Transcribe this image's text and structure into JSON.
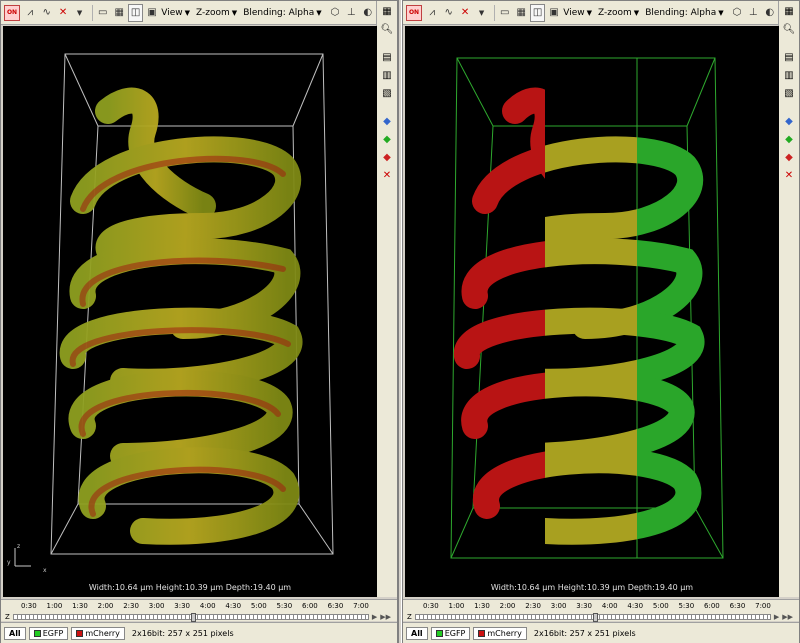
{
  "toolbar": {
    "view_label": "View",
    "zoom_label": "Z-zoom",
    "blending_label": "Blending: Alpha",
    "channel_badge": "ON"
  },
  "panes": [
    {
      "dims_text": "Width:10.64 µm Height:10.39 µm Depth:19.40 µm",
      "timeline_ticks": [
        "0:30",
        "1:00",
        "1:30",
        "2:00",
        "2:30",
        "3:00",
        "3:30",
        "4:00",
        "4:30",
        "5:00",
        "5:30",
        "6:00",
        "6:30",
        "7:00"
      ],
      "z_label": "Z",
      "tabs": {
        "all": "All",
        "egfp": "EGFP",
        "mcherry": "mCherry"
      },
      "status": "2x16bit: 257 x 251 pixels"
    },
    {
      "dims_text": "Width:10.64 µm Height:10.39 µm Depth:19.40 µm",
      "timeline_ticks": [
        "0:30",
        "1:00",
        "1:30",
        "2:00",
        "2:30",
        "3:00",
        "3:30",
        "4:00",
        "4:30",
        "5:00",
        "5:30",
        "6:00",
        "6:30",
        "7:00"
      ],
      "z_label": "Z",
      "tabs": {
        "all": "All",
        "egfp": "EGFP",
        "mcherry": "mCherry"
      },
      "status": "2x16bit: 257 x 251 pixels"
    }
  ],
  "colors": {
    "egfp": "#22cc22",
    "mcherry": "#cc1111",
    "merged": "#a7a020"
  },
  "axis": {
    "z": "z",
    "y": "y",
    "x": "x"
  }
}
